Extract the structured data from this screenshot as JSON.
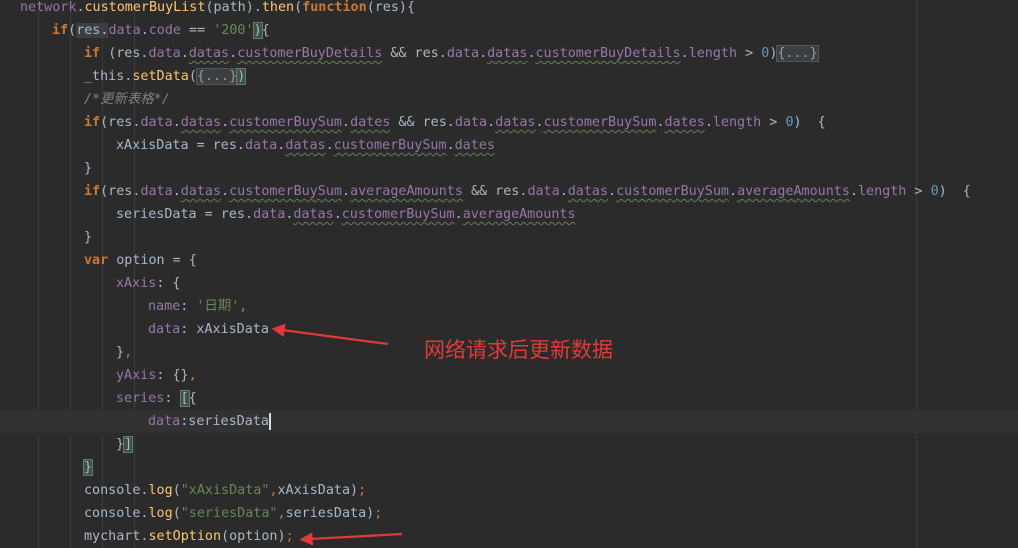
{
  "editor": {
    "theme": "darcula",
    "colors": {
      "background": "#2b2b2b",
      "current_line": "#323232",
      "keyword": "#cc7832",
      "property": "#9876aa",
      "function": "#ffc66d",
      "string": "#6a8759",
      "number": "#6897bb",
      "comment": "#808080",
      "text": "#a9b7c6",
      "annotation": "#e23a3a"
    },
    "current_line_index": 18,
    "lines": [
      {
        "indent": 0,
        "tokens": [
          [
            "network",
            "prop"
          ],
          [
            ".",
            "plain"
          ],
          [
            "customerBuyList",
            "fn"
          ],
          [
            "(path).",
            "plain"
          ],
          [
            "then",
            "fn"
          ],
          [
            "(",
            "plain"
          ],
          [
            "function",
            "kw"
          ],
          [
            "(res){",
            "plain"
          ]
        ]
      },
      {
        "indent": 1,
        "tokens": [
          [
            "if",
            "kw"
          ],
          [
            "(",
            "plain"
          ],
          [
            "res.",
            "hl"
          ],
          [
            "data",
            "prop"
          ],
          [
            ".",
            "plain"
          ],
          [
            "code",
            "prop"
          ],
          [
            " == ",
            "plain"
          ],
          [
            "'200'",
            "str"
          ],
          [
            ")",
            "br"
          ],
          [
            "{",
            "plain"
          ]
        ]
      },
      {
        "indent": 2,
        "tokens": [
          [
            "if ",
            "kw"
          ],
          [
            "(res.",
            "plain"
          ],
          [
            "data",
            "prop"
          ],
          [
            ".",
            "plain"
          ],
          [
            "datas",
            "prop-sq"
          ],
          [
            ".",
            "plain"
          ],
          [
            "customerBuyDetails",
            "prop-sq"
          ],
          [
            " && res.",
            "plain"
          ],
          [
            "data",
            "prop"
          ],
          [
            ".",
            "plain"
          ],
          [
            "datas",
            "prop-sq"
          ],
          [
            ".",
            "plain"
          ],
          [
            "customerBuyDetails",
            "prop-sq"
          ],
          [
            ".",
            "plain"
          ],
          [
            "length",
            "prop"
          ],
          [
            " > ",
            "plain"
          ],
          [
            "0",
            "num"
          ],
          [
            ")",
            "plain"
          ],
          [
            "{...}",
            "fold"
          ]
        ]
      },
      {
        "indent": 2,
        "tokens": [
          [
            "_this.",
            "plain"
          ],
          [
            "setData",
            "fn"
          ],
          [
            "(",
            "plain"
          ],
          [
            "{...}",
            "fold"
          ],
          [
            ")",
            "br"
          ]
        ]
      },
      {
        "indent": 2,
        "tokens": [
          [
            "/*更新表格*/",
            "comment"
          ]
        ]
      },
      {
        "indent": 2,
        "tokens": [
          [
            "if",
            "kw"
          ],
          [
            "(res.",
            "plain"
          ],
          [
            "data",
            "prop"
          ],
          [
            ".",
            "plain"
          ],
          [
            "datas",
            "prop-sq"
          ],
          [
            ".",
            "plain"
          ],
          [
            "customerBuySum",
            "prop-sq"
          ],
          [
            ".",
            "plain"
          ],
          [
            "dates",
            "prop-sq"
          ],
          [
            " && res.",
            "plain"
          ],
          [
            "data",
            "prop"
          ],
          [
            ".",
            "plain"
          ],
          [
            "datas",
            "prop-sq"
          ],
          [
            ".",
            "plain"
          ],
          [
            "customerBuySum",
            "prop-sq"
          ],
          [
            ".",
            "plain"
          ],
          [
            "dates",
            "prop-sq"
          ],
          [
            ".",
            "plain"
          ],
          [
            "length",
            "prop"
          ],
          [
            " > ",
            "plain"
          ],
          [
            "0",
            "num"
          ],
          [
            ")  {",
            "plain"
          ]
        ]
      },
      {
        "indent": 3,
        "tokens": [
          [
            "xAxisData = res.",
            "plain"
          ],
          [
            "data",
            "prop"
          ],
          [
            ".",
            "plain"
          ],
          [
            "datas",
            "prop-sq"
          ],
          [
            ".",
            "plain"
          ],
          [
            "customerBuySum",
            "prop-sq"
          ],
          [
            ".",
            "plain"
          ],
          [
            "dates",
            "prop-sq"
          ]
        ]
      },
      {
        "indent": 2,
        "tokens": [
          [
            "}",
            "plain"
          ]
        ]
      },
      {
        "indent": 2,
        "tokens": [
          [
            "if",
            "kw"
          ],
          [
            "(res.",
            "plain"
          ],
          [
            "data",
            "prop"
          ],
          [
            ".",
            "plain"
          ],
          [
            "datas",
            "prop-sq"
          ],
          [
            ".",
            "plain"
          ],
          [
            "customerBuySum",
            "prop-sq"
          ],
          [
            ".",
            "plain"
          ],
          [
            "averageAmounts",
            "prop-sq"
          ],
          [
            " && res.",
            "plain"
          ],
          [
            "data",
            "prop"
          ],
          [
            ".",
            "plain"
          ],
          [
            "datas",
            "prop-sq"
          ],
          [
            ".",
            "plain"
          ],
          [
            "customerBuySum",
            "prop-sq"
          ],
          [
            ".",
            "plain"
          ],
          [
            "averageAmounts",
            "prop-sq"
          ],
          [
            ".",
            "plain"
          ],
          [
            "length",
            "prop"
          ],
          [
            " > ",
            "plain"
          ],
          [
            "0",
            "num"
          ],
          [
            ")  {",
            "plain"
          ]
        ]
      },
      {
        "indent": 3,
        "tokens": [
          [
            "seriesData = res.",
            "plain"
          ],
          [
            "data",
            "prop"
          ],
          [
            ".",
            "plain"
          ],
          [
            "datas",
            "prop-sq"
          ],
          [
            ".",
            "plain"
          ],
          [
            "customerBuySum",
            "prop-sq"
          ],
          [
            ".",
            "plain"
          ],
          [
            "averageAmounts",
            "prop-sq"
          ]
        ]
      },
      {
        "indent": 2,
        "tokens": [
          [
            "}",
            "plain"
          ]
        ]
      },
      {
        "indent": 2,
        "tokens": [
          [
            "var ",
            "kw"
          ],
          [
            "option = {",
            "plain"
          ]
        ]
      },
      {
        "indent": 3,
        "tokens": [
          [
            "xAxis",
            "prop"
          ],
          [
            ": {",
            "plain"
          ]
        ]
      },
      {
        "indent": 4,
        "tokens": [
          [
            "name",
            "prop"
          ],
          [
            ": ",
            "plain"
          ],
          [
            "'日期'",
            "str"
          ],
          [
            ",",
            "punc"
          ]
        ]
      },
      {
        "indent": 4,
        "tokens": [
          [
            "data",
            "prop"
          ],
          [
            ": xAxisData",
            "plain"
          ]
        ]
      },
      {
        "indent": 3,
        "tokens": [
          [
            "}",
            "plain"
          ],
          [
            ",",
            "punc"
          ]
        ]
      },
      {
        "indent": 3,
        "tokens": [
          [
            "yAxis",
            "prop"
          ],
          [
            ": {}",
            "plain"
          ],
          [
            ",",
            "punc"
          ]
        ]
      },
      {
        "indent": 3,
        "tokens": [
          [
            "series",
            "prop"
          ],
          [
            ": ",
            "plain"
          ],
          [
            "[",
            "br"
          ],
          [
            "{",
            "plain"
          ]
        ]
      },
      {
        "indent": 4,
        "tokens": [
          [
            "data",
            "prop"
          ],
          [
            ":seriesData",
            "plain"
          ]
        ]
      },
      {
        "indent": 3,
        "tokens": [
          [
            "}",
            "plain"
          ],
          [
            "]",
            "br"
          ]
        ]
      },
      {
        "indent": 2,
        "tokens": [
          [
            "}",
            "br"
          ]
        ]
      },
      {
        "indent": 2,
        "tokens": [
          [
            "console.",
            "plain"
          ],
          [
            "log",
            "fn"
          ],
          [
            "(",
            "plain"
          ],
          [
            "\"xAxisData\"",
            "str"
          ],
          [
            ",",
            "punc"
          ],
          [
            "xAxisData)",
            "plain"
          ],
          [
            ";",
            "punc"
          ]
        ]
      },
      {
        "indent": 2,
        "tokens": [
          [
            "console.",
            "plain"
          ],
          [
            "log",
            "fn"
          ],
          [
            "(",
            "plain"
          ],
          [
            "\"seriesData\"",
            "str"
          ],
          [
            ",",
            "punc"
          ],
          [
            "seriesData)",
            "plain"
          ],
          [
            ";",
            "punc"
          ]
        ]
      },
      {
        "indent": 2,
        "tokens": [
          [
            "mychart.",
            "plain"
          ],
          [
            "setOption",
            "fn"
          ],
          [
            "(option)",
            "plain"
          ],
          [
            ";",
            "punc"
          ]
        ]
      }
    ]
  },
  "annotation": {
    "text": "网络请求后更新数据",
    "arrows": [
      {
        "points_to": "data: xAxisData"
      },
      {
        "points_to": "mychart.setOption(option);"
      }
    ]
  }
}
